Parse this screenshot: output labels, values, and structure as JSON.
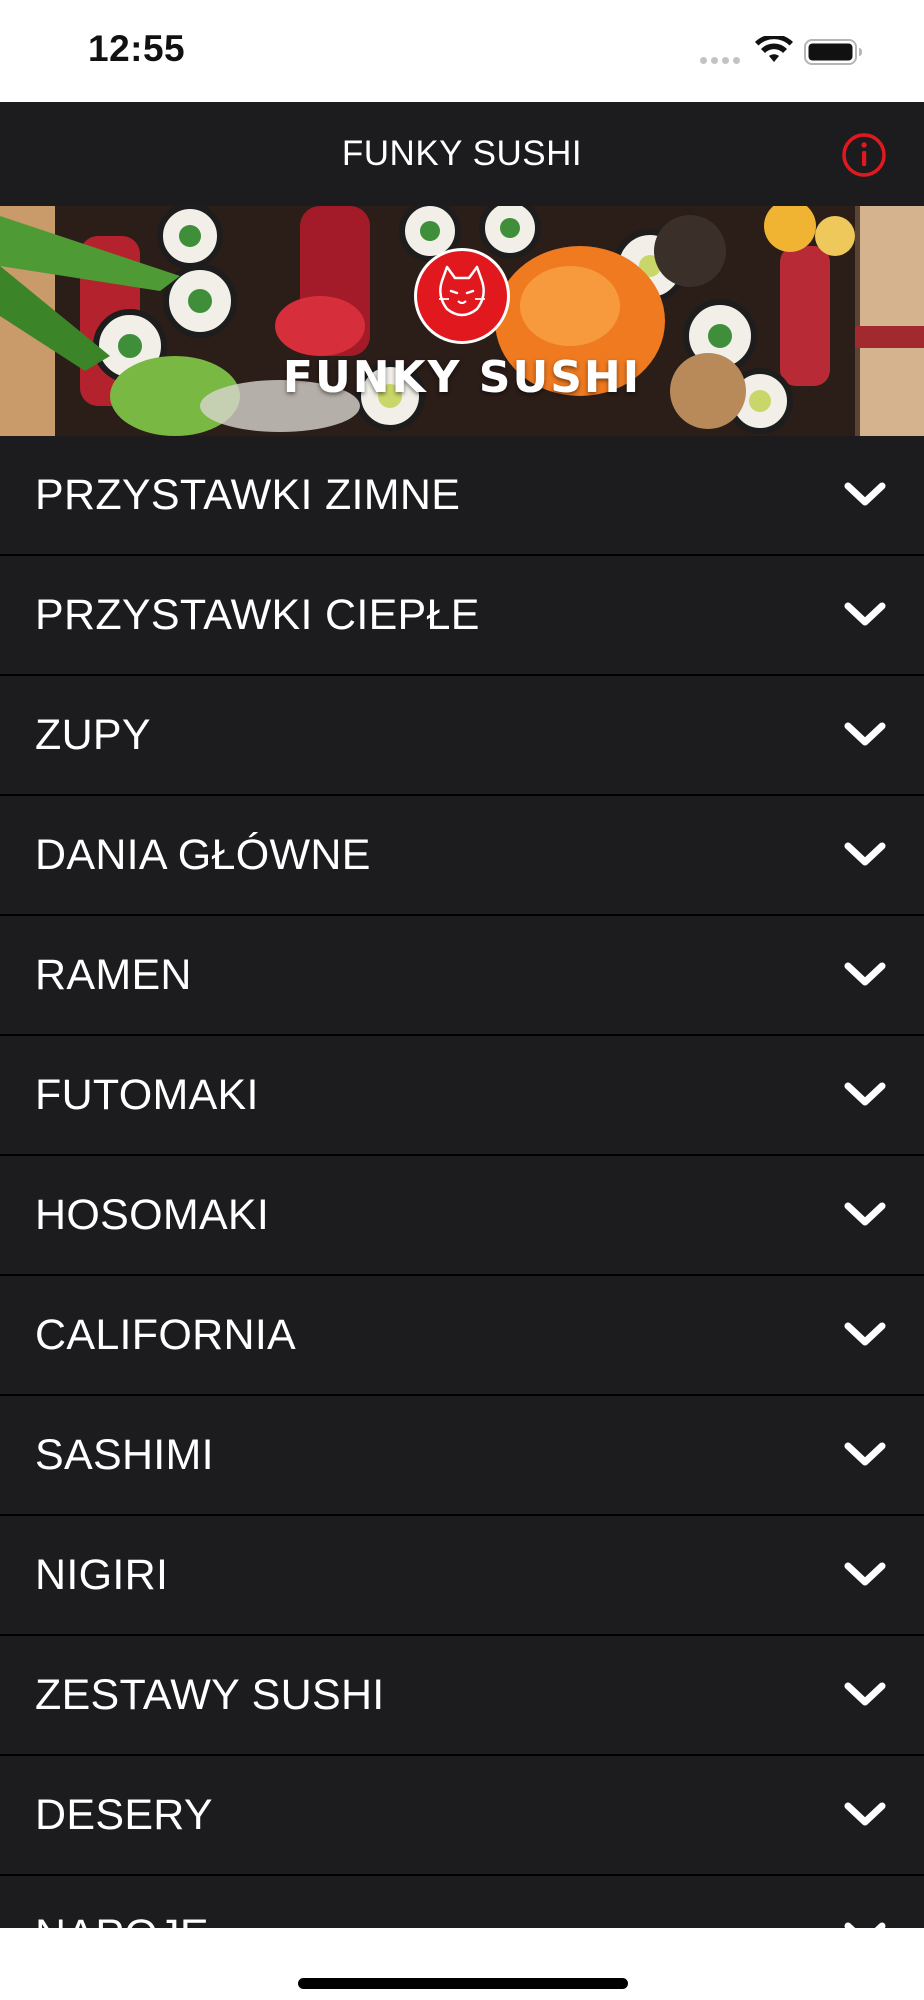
{
  "status_bar": {
    "time": "12:55",
    "icons": [
      "signal-icon",
      "wifi-icon",
      "battery-icon"
    ]
  },
  "header": {
    "title": "FUNKY SUSHI",
    "info_icon": "info-circle-icon",
    "accent_color": "#e1191f"
  },
  "hero": {
    "brand_text": "FUNKY SUSHI",
    "logo_icon": "cat-mascot-icon"
  },
  "categories": [
    {
      "label": "PRZYSTAWKI ZIMNE"
    },
    {
      "label": "PRZYSTAWKI CIEPŁE"
    },
    {
      "label": "ZUPY"
    },
    {
      "label": "DANIA GŁÓWNE"
    },
    {
      "label": "RAMEN"
    },
    {
      "label": "FUTOMAKI"
    },
    {
      "label": "HOSOMAKI"
    },
    {
      "label": "CALIFORNIA"
    },
    {
      "label": "SASHIMI"
    },
    {
      "label": "NIGIRI"
    },
    {
      "label": "ZESTAWY SUSHI"
    },
    {
      "label": "DESERY"
    },
    {
      "label": "NAPOJE"
    }
  ],
  "colors": {
    "list_background": "#1c1c1e",
    "divider": "#000000",
    "text": "#ffffff"
  }
}
